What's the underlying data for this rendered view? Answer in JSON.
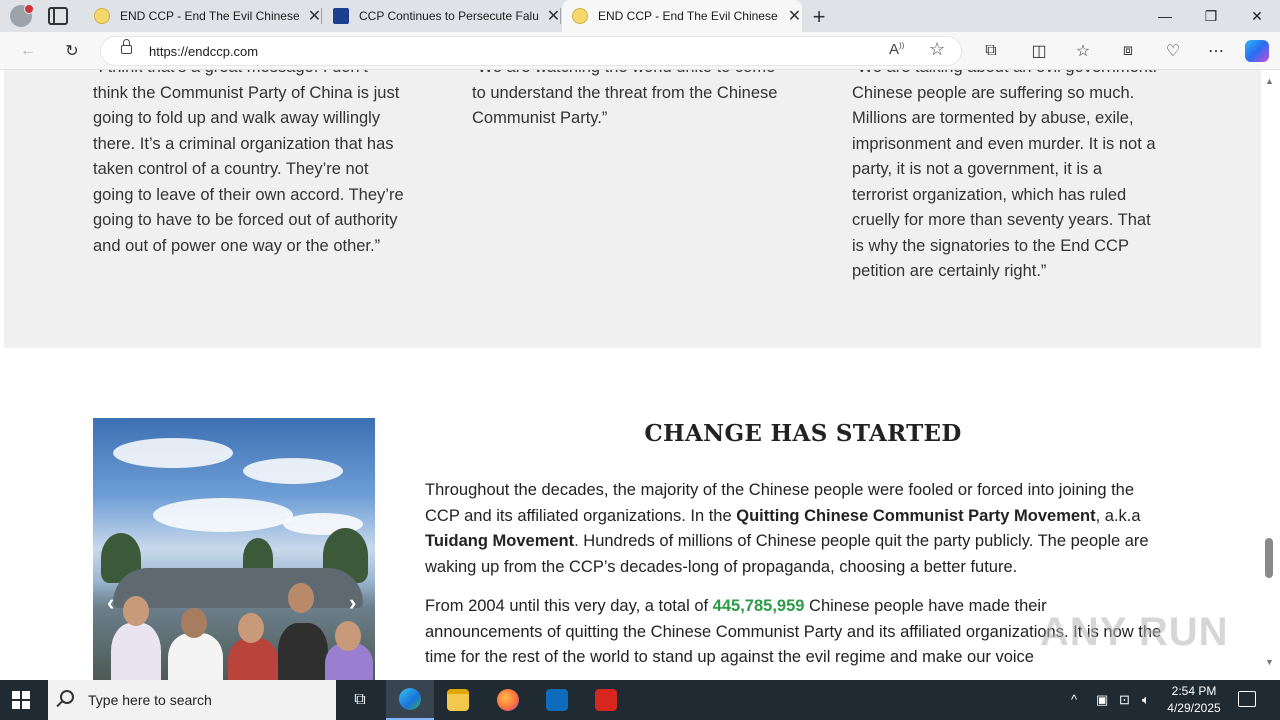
{
  "browser": {
    "tabs": [
      {
        "title": "END CCP - End The Evil Chinese Communist Party",
        "favicon": "smiley-favicon-icon"
      },
      {
        "title": "CCP Continues to Persecute Falun Gong",
        "favicon": "news-favicon-icon"
      },
      {
        "title": "END CCP - End The Evil Chinese Communist Party",
        "favicon": "smiley-favicon-icon"
      }
    ],
    "active_tab": 2,
    "url": "https://endccp.com"
  },
  "quotes": {
    "q1_lines": [
      "“I think that’s a great message. I don’t",
      "think the Communist Party of China is just",
      "going to fold up and walk away willingly",
      "there. It’s a criminal organization that has",
      "taken control of a country. They’re not",
      "going to leave of their own accord. They’re",
      "going to have to be forced out of authority",
      "and out of power one way or the other.”"
    ],
    "q2_lines": [
      "“We are watching the world unite to come",
      "to understand the threat from the Chinese",
      "Communist Party.”"
    ],
    "q3_lines": [
      "“We are talking about an evil government.",
      "Chinese people are suffering so much.",
      "Millions are tormented by abuse, exile,",
      "imprisonment and even murder. It is not a",
      "party, it is not a government, it is a",
      "terrorist organization, which has ruled",
      "cruelly for more than seventy years. That",
      "is why the signatories to the End CCP",
      "petition are certainly right.”"
    ]
  },
  "section": {
    "title": "CHANGE HAS STARTED",
    "p1_a": "Throughout the decades, the majority of the Chinese people were fooled or forced into joining the CCP and its affiliated organizations. In the ",
    "p1_b": "Quitting Chinese Communist Party Movement",
    "p1_c": ", a.k.a ",
    "p1_d": "Tuidang Movement",
    "p1_e": ". Hundreds of millions of Chinese people quit the party publicly. The people are waking up from the CCP’s decades-long of propaganda, choosing a better future.",
    "p2_a": "From 2004 until this very day, a total of ",
    "p2_count": "445,785,959",
    "p2_b": " Chinese people have made their announcements of quitting the Chinese Communist Party and its affiliated organizations. It is now the time for the rest of the world to stand up against the evil regime and make our voice"
  },
  "carousel": {
    "prev": "‹",
    "next": "›"
  },
  "watermark": "ANY RUN",
  "taskbar": {
    "search_placeholder": "Type here to search",
    "time": "2:54 PM",
    "date": "4/29/2025"
  },
  "colors": {
    "accent_count": "#2e9a4a",
    "taskbar": "#1f2a33",
    "band": "#f0f0f0"
  }
}
